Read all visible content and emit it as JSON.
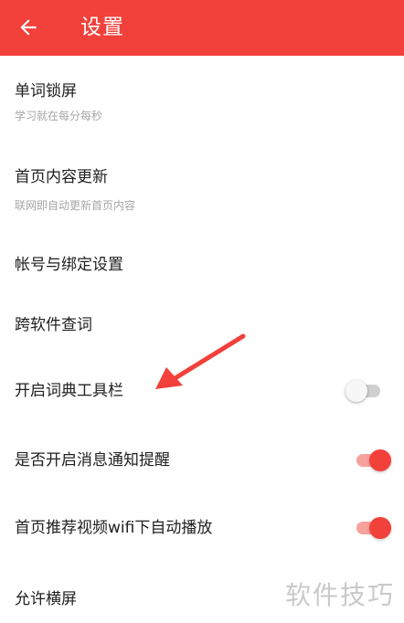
{
  "appbar": {
    "title": "设置",
    "back_icon": "arrow-left-icon",
    "color": "#f2403a"
  },
  "settings": [
    {
      "title": "单词锁屏",
      "subtitle": "学习就在每分每秒"
    },
    {
      "title": "首页内容更新",
      "subtitle": "联网即自动更新首页内容"
    },
    {
      "title": "帐号与绑定设置"
    },
    {
      "title": "跨软件查词"
    },
    {
      "title": "开启词典工具栏",
      "toggle": false
    },
    {
      "title": "是否开启消息通知提醒",
      "toggle": true
    },
    {
      "title": "首页推荐视频wifi下自动播放",
      "toggle": true
    },
    {
      "title": "允许横屏"
    }
  ],
  "annotation": {
    "icon": "red-arrow-icon",
    "color": "#f2403a"
  },
  "watermark": "软件技巧"
}
